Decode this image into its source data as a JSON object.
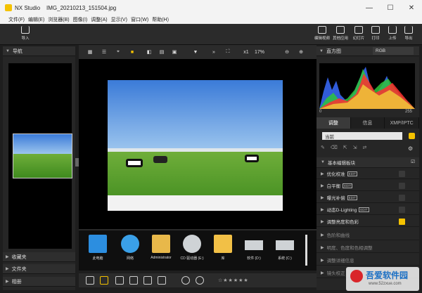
{
  "window": {
    "app_name": "NX Studio",
    "file_name": "IMG_20210213_151504.jpg"
  },
  "menu": [
    "文件(F)",
    "编辑(E)",
    "浏览器(B)",
    "图像(I)",
    "调整(A)",
    "显示(V)",
    "窗口(W)",
    "帮助(H)"
  ],
  "toolbar": {
    "import_label": "导入",
    "right_tools": [
      {
        "label": "编辑视频",
        "icon": "edit-video-icon"
      },
      {
        "label": "其他应用",
        "icon": "other-apps-icon"
      },
      {
        "label": "幻灯片",
        "icon": "slideshow-icon"
      },
      {
        "label": "打印",
        "icon": "print-icon"
      },
      {
        "label": "上传",
        "icon": "upload-icon"
      },
      {
        "label": "导出",
        "icon": "export-icon"
      }
    ]
  },
  "left_panel": {
    "nav_title": "导航",
    "favorites": "收藏夹",
    "folders": "文件夹",
    "albums": "相册"
  },
  "viewbar": {
    "zoom_factor": "x1",
    "zoom_percent": "17%"
  },
  "filmstrip": [
    "此电脑",
    "网络",
    "Administrator",
    "CD 驱动器 (E:)",
    "库",
    "软件 (D:)",
    "系统 (C:)"
  ],
  "right_panel": {
    "histogram_title": "直方图",
    "color_channel": "RGB",
    "histogram_min": "0",
    "histogram_max": "255",
    "tabs": [
      "调整",
      "信息",
      "XMP/IPTC"
    ],
    "preset": "当前",
    "basic_edit": "基本编辑板块",
    "items": [
      {
        "label": "优化校准",
        "tag": "EDIT",
        "checked": false
      },
      {
        "label": "白平衡",
        "tag": "EDIT",
        "checked": false
      },
      {
        "label": "曝光补偿",
        "tag": "EDIT",
        "checked": false
      },
      {
        "label": "动态D-Lighting",
        "tag": "EDIT",
        "checked": false
      },
      {
        "label": "调整亮度和色彩",
        "tag": "",
        "checked": true
      }
    ],
    "sections": [
      "色阶和曲线",
      "明度、色度和色相调整",
      "调整详细信息",
      "镜头校正"
    ]
  },
  "colors": {
    "accent": "#f4c200",
    "panel": "#262626",
    "titlebar": "#f3f3f3"
  },
  "watermark": {
    "text": "吾爱软件园",
    "url": "www.52zxue.com"
  }
}
